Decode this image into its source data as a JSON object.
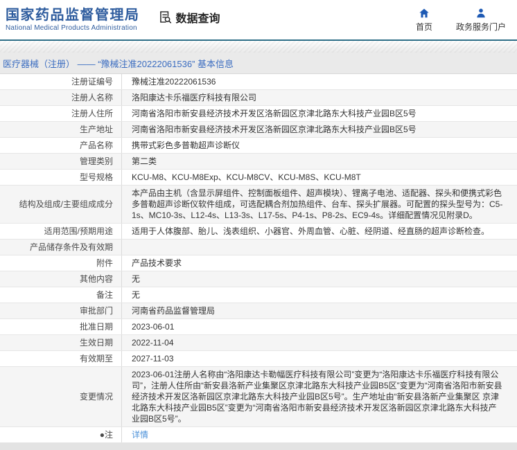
{
  "header": {
    "logo_title": "国家药品监督管理局",
    "logo_subtitle": "National Medical Products Administration",
    "nav_query": "数据查询",
    "nav_home": "首页",
    "nav_portal": "政务服务门户"
  },
  "breadcrumb": "医疗器械（注册） —— “豫械注准20222061536” 基本信息",
  "table": {
    "rows": [
      {
        "label": "注册证编号",
        "value": "豫械注准20222061536"
      },
      {
        "label": "注册人名称",
        "value": "洛阳康达卡乐福医疗科技有限公司"
      },
      {
        "label": "注册人住所",
        "value": "河南省洛阳市新安县经济技术开发区洛新园区京津北路东大科技产业园B区5号"
      },
      {
        "label": "生产地址",
        "value": "河南省洛阳市新安县经济技术开发区洛新园区京津北路东大科技产业园B区5号"
      },
      {
        "label": "产品名称",
        "value": "携带式彩色多普勒超声诊断仪"
      },
      {
        "label": "管理类别",
        "value": "第二类"
      },
      {
        "label": "型号规格",
        "value": "KCU-M8、KCU-M8Exp、KCU-M8CV、KCU-M8S、KCU-M8T"
      },
      {
        "label": "结构及组成/主要组成成分",
        "value": "本产品由主机（含显示屏组件、控制面板组件、超声模块）、锂离子电池、适配器、探头和便携式彩色多普勒超声诊断仪软件组成，可选配耦合剂加热组件、台车、探头扩展器。可配置的探头型号为：C5-1s、MC10-3s、L12-4s、L13-3s、L17-5s、P4-1s、P8-2s、EC9-4s。详细配置情况见附录D。"
      },
      {
        "label": "适用范围/预期用途",
        "value": "适用于人体腹部、胎儿、浅表组织、小器官、外周血管、心脏、经阴道、经直肠的超声诊断检查。"
      },
      {
        "label": "产品储存条件及有效期",
        "value": ""
      },
      {
        "label": "附件",
        "value": "产品技术要求"
      },
      {
        "label": "其他内容",
        "value": "无"
      },
      {
        "label": "备注",
        "value": "无"
      },
      {
        "label": "审批部门",
        "value": "河南省药品监督管理局"
      },
      {
        "label": "批准日期",
        "value": "2023-06-01"
      },
      {
        "label": "生效日期",
        "value": "2022-11-04"
      },
      {
        "label": "有效期至",
        "value": "2027-11-03"
      },
      {
        "label": "变更情况",
        "value": "2023-06-01注册人名称由“洛阳康达卡勒幅医疗科技有限公司”变更为“洛阳康达卡乐福医疗科技有限公司”，注册人住所由“新安县洛新产业集聚区京津北路东大科技产业园B5区”变更为“河南省洛阳市新安县经济技术开发区洛新园区京津北路东大科技产业园B区5号”。生产地址由“新安县洛新产业集聚区 京津北路东大科技产业园B5区”变更为“河南省洛阳市新安县经济技术开发区洛新园区京津北路东大科技产业园B区5号”。"
      },
      {
        "label": "●注",
        "value": "详情",
        "type": "link"
      }
    ]
  },
  "colors": {
    "brand_blue": "#2e5c9e",
    "icon_blue": "#1e5ab4",
    "accent_teal": "#2d6e87",
    "link_blue": "#4a90d9",
    "breadcrumb_blue": "#3a6cc0",
    "stripe_gray": "#f5f5f5"
  }
}
